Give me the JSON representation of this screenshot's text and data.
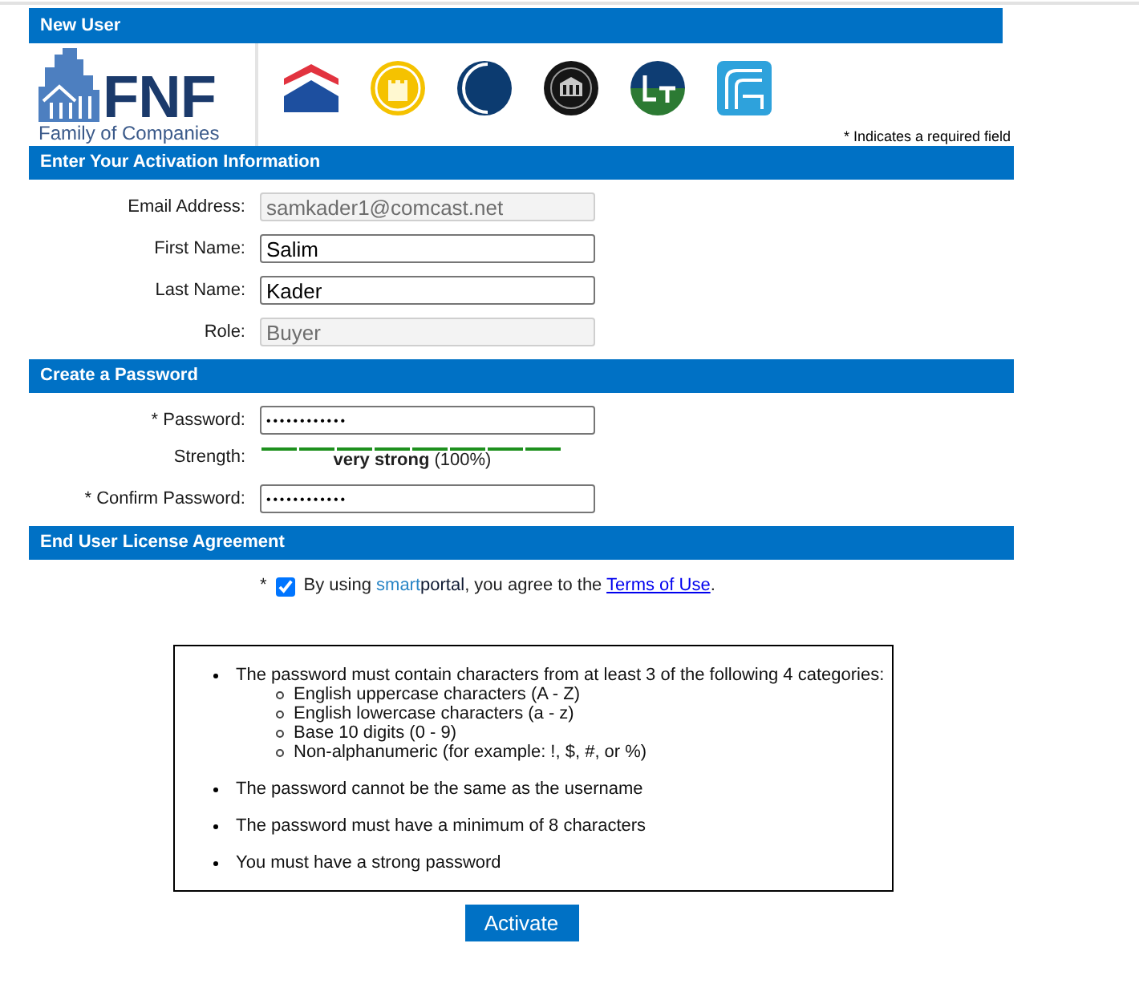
{
  "header": {
    "title": "New User"
  },
  "logo": {
    "wordmark": "FNF",
    "tagline": "Family of Companies"
  },
  "required_note": "* Indicates a required field",
  "sections": [
    {
      "title": "Enter Your Activation Information",
      "rows": [
        {
          "kind": "field",
          "label": "Email Address:",
          "value": "samkader1@comcast.net",
          "disabled": true
        },
        {
          "kind": "field",
          "label": "First Name:",
          "value": "Salim",
          "disabled": false
        },
        {
          "kind": "field",
          "label": "Last Name:",
          "value": "Kader",
          "disabled": false
        },
        {
          "kind": "field",
          "label": "Role:",
          "value": "Buyer",
          "disabled": true
        }
      ]
    },
    {
      "title": "Create a Password",
      "rows": [
        {
          "kind": "password",
          "label": "* Password:",
          "value": "••••••••••••",
          "disabled": false
        },
        {
          "kind": "strength",
          "label": "Strength:",
          "level": 1,
          "reading": "**very strong** (100%)"
        },
        {
          "kind": "password",
          "label": "* Confirm Password:",
          "value": "••••••••••••",
          "disabled": false
        }
      ]
    },
    {
      "title": "End User License Agreement",
      "rows": [
        {
          "kind": "agreement",
          "required_mark": "*",
          "checked": true,
          "parts": [
            {
              "kind": "text",
              "text": "By using "
            },
            {
              "kind": "brand_light",
              "text": "smart"
            },
            {
              "kind": "brand_dark",
              "text": "portal"
            },
            {
              "kind": "text",
              "text": ", you agree to the "
            },
            {
              "kind": "link",
              "text": "Terms of Use"
            },
            {
              "kind": "text",
              "text": "."
            }
          ]
        }
      ]
    }
  ],
  "rules": [
    {
      "text": "The password must contain characters from at least 3 of the following 4 categories:",
      "children": [
        {
          "text": "English uppercase characters (A - Z)"
        },
        {
          "text": "English lowercase characters (a - z)"
        },
        {
          "text": "Base 10 digits (0 - 9)"
        },
        {
          "text": "Non-alphanumeric (for example: !, $, #, or %)"
        }
      ]
    },
    {
      "text": "The password cannot be the same as the username"
    },
    {
      "text": "The password must have a minimum of 8 characters"
    },
    {
      "text": "You must have a strong password"
    }
  ],
  "submit": {
    "label": "Activate"
  }
}
